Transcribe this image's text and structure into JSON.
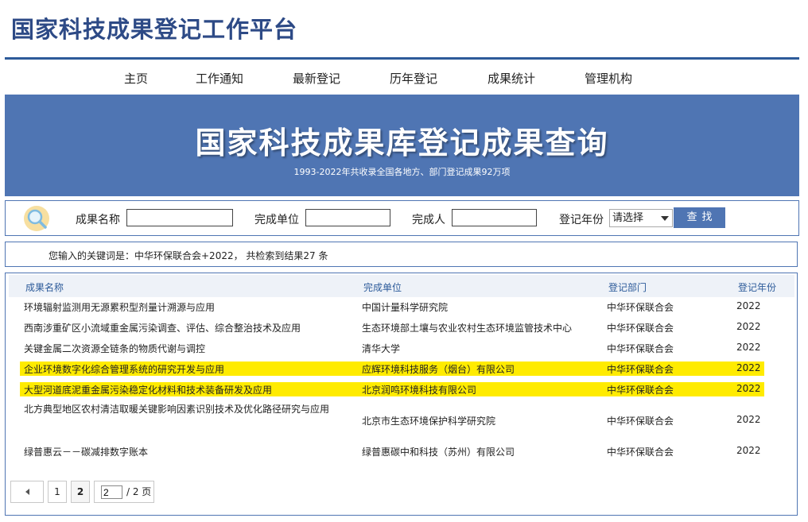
{
  "site": {
    "title": "国家科技成果登记工作平台"
  },
  "nav": [
    "主页",
    "工作通知",
    "最新登记",
    "历年登记",
    "成果统计",
    "管理机构"
  ],
  "banner": {
    "title": "国家科技成果库登记成果查询",
    "subtitle": "1993-2022年共收录全国各地方、部门登记成果92万项"
  },
  "search": {
    "name_label": "成果名称",
    "name_value": "",
    "unit_label": "完成单位",
    "unit_value": "",
    "person_label": "完成人",
    "person_value": "",
    "year_label": "登记年份",
    "year_value": "请选择",
    "button": "查找"
  },
  "keyword_line": "您输入的关键词是：中华环保联合会+2022， 共检索到结果27 条",
  "table": {
    "headers": [
      "成果名称",
      "完成单位",
      "登记部门",
      "登记年份"
    ],
    "rows": [
      {
        "name": "环境辐射监测用无源累积型剂量计溯源与应用",
        "unit": "中国计量科学研究院",
        "dept": "中华环保联合会",
        "year": "2022",
        "highlight": false
      },
      {
        "name": "西南涉重矿区小流域重金属污染调查、评估、综合整治技术及应用",
        "unit": "生态环境部土壤与农业农村生态环境监管技术中心",
        "dept": "中华环保联合会",
        "year": "2022",
        "highlight": false
      },
      {
        "name": "关键金属二次资源全链条的物质代谢与调控",
        "unit": "清华大学",
        "dept": "中华环保联合会",
        "year": "2022",
        "highlight": false
      },
      {
        "name": "企业环境数字化综合管理系统的研究开发与应用",
        "unit": "应辉环境科技服务（烟台）有限公司",
        "dept": "中华环保联合会",
        "year": "2022",
        "highlight": true
      },
      {
        "name": "大型河道底泥重金属污染稳定化材料和技术装备研发及应用",
        "unit": "北京润鸣环境科技有限公司",
        "dept": "中华环保联合会",
        "year": "2022",
        "highlight": true
      },
      {
        "name": "北方典型地区农村清洁取暖关键影响因素识别技术及优化路径研究与应用",
        "unit": "北京市生态环境保护科学研究院",
        "dept": "中华环保联合会",
        "year": "2022",
        "highlight": false
      },
      {
        "name": "绿普惠云－－碳减排数字账本",
        "unit": "绿普惠碳中和科技（苏州）有限公司",
        "dept": "中华环保联合会",
        "year": "2022",
        "highlight": false
      }
    ]
  },
  "pager": {
    "pages": [
      "1",
      "2"
    ],
    "current": "2",
    "input_value": "2",
    "total": "/ 2 页"
  }
}
